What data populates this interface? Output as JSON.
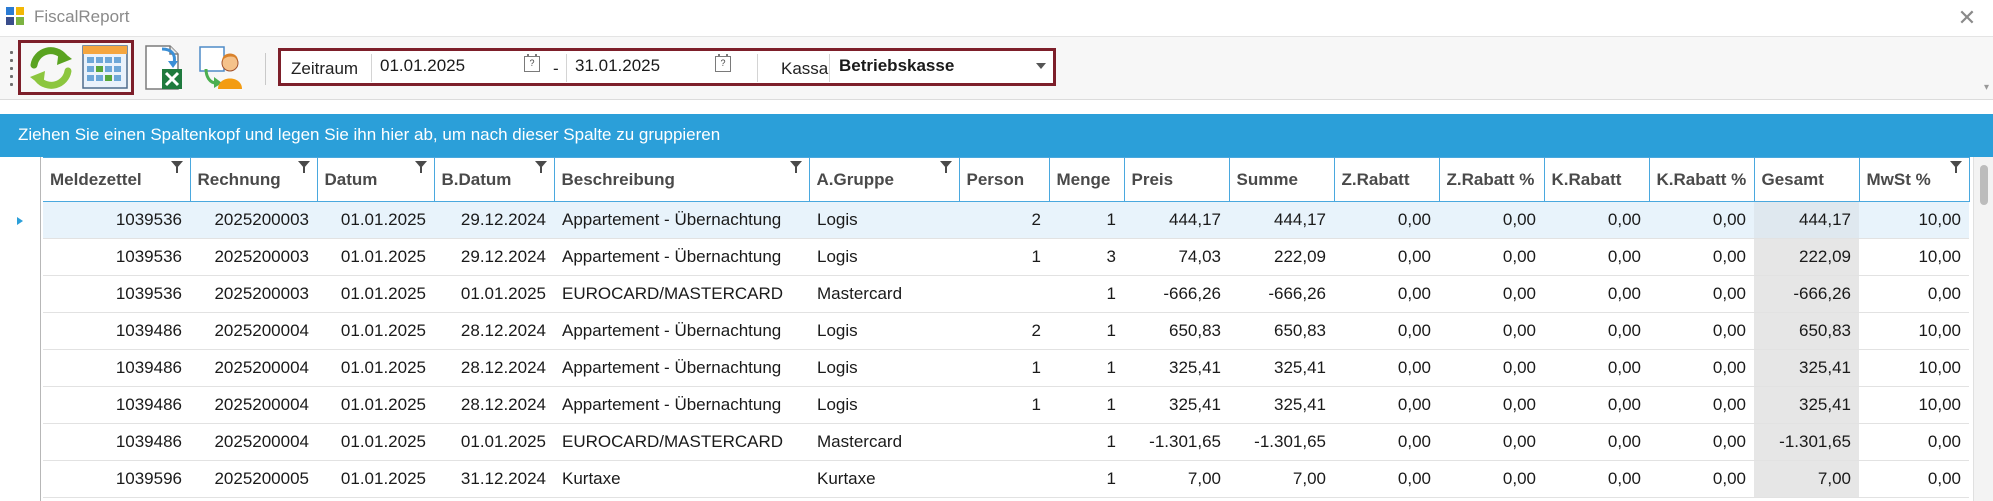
{
  "window": {
    "title": "FiscalReport",
    "close_glyph": "✕"
  },
  "toolbar": {
    "buttons": [
      {
        "name": "refresh-icon"
      },
      {
        "name": "calendar-grid-icon"
      },
      {
        "name": "excel-export-icon"
      },
      {
        "name": "user-export-icon"
      }
    ],
    "zeitraum_label": "Zeitraum",
    "date_from": "01.01.2025",
    "date_separator": "-",
    "date_to": "31.01.2025",
    "kassa_label": "Kassa",
    "kassa_value": "Betriebskasse"
  },
  "group_panel": {
    "text": "Ziehen Sie einen Spaltenkopf und legen Sie ihn hier ab, um nach dieser Spalte zu gruppieren"
  },
  "columns": [
    "Meldezettel",
    "Rechnung",
    "Datum",
    "B.Datum",
    "Beschreibung",
    "A.Gruppe",
    "Person",
    "Menge",
    "Preis",
    "Summe",
    "Z.Rabatt",
    "Z.Rabatt %",
    "K.Rabatt",
    "K.Rabatt %",
    "Gesamt",
    "MwSt %"
  ],
  "rows": [
    [
      "1039536",
      "2025200003",
      "01.01.2025",
      "29.12.2024",
      "Appartement - Übernachtung",
      "Logis",
      "2",
      "1",
      "444,17",
      "444,17",
      "0,00",
      "0,00",
      "0,00",
      "0,00",
      "444,17",
      "10,00"
    ],
    [
      "1039536",
      "2025200003",
      "01.01.2025",
      "29.12.2024",
      "Appartement - Übernachtung",
      "Logis",
      "1",
      "3",
      "74,03",
      "222,09",
      "0,00",
      "0,00",
      "0,00",
      "0,00",
      "222,09",
      "10,00"
    ],
    [
      "1039536",
      "2025200003",
      "01.01.2025",
      "01.01.2025",
      "EUROCARD/MASTERCARD",
      "Mastercard",
      "",
      "1",
      "-666,26",
      "-666,26",
      "0,00",
      "0,00",
      "0,00",
      "0,00",
      "-666,26",
      "0,00"
    ],
    [
      "1039486",
      "2025200004",
      "01.01.2025",
      "28.12.2024",
      "Appartement - Übernachtung",
      "Logis",
      "2",
      "1",
      "650,83",
      "650,83",
      "0,00",
      "0,00",
      "0,00",
      "0,00",
      "650,83",
      "10,00"
    ],
    [
      "1039486",
      "2025200004",
      "01.01.2025",
      "28.12.2024",
      "Appartement - Übernachtung",
      "Logis",
      "1",
      "1",
      "325,41",
      "325,41",
      "0,00",
      "0,00",
      "0,00",
      "0,00",
      "325,41",
      "10,00"
    ],
    [
      "1039486",
      "2025200004",
      "01.01.2025",
      "28.12.2024",
      "Appartement - Übernachtung",
      "Logis",
      "1",
      "1",
      "325,41",
      "325,41",
      "0,00",
      "0,00",
      "0,00",
      "0,00",
      "325,41",
      "10,00"
    ],
    [
      "1039486",
      "2025200004",
      "01.01.2025",
      "01.01.2025",
      "EUROCARD/MASTERCARD",
      "Mastercard",
      "",
      "1",
      "-1.301,65",
      "-1.301,65",
      "0,00",
      "0,00",
      "0,00",
      "0,00",
      "-1.301,65",
      "0,00"
    ],
    [
      "1039596",
      "2025200005",
      "01.01.2025",
      "31.12.2024",
      "Kurtaxe",
      "Kurtaxe",
      "",
      "1",
      "7,00",
      "7,00",
      "0,00",
      "0,00",
      "0,00",
      "0,00",
      "7,00",
      "0,00"
    ]
  ],
  "colors": {
    "accent": "#2b9fd9",
    "highlight_box": "#7d1f2a",
    "selected_row": "#e8f3fb",
    "gesamt_column": "#e6e6e6"
  }
}
